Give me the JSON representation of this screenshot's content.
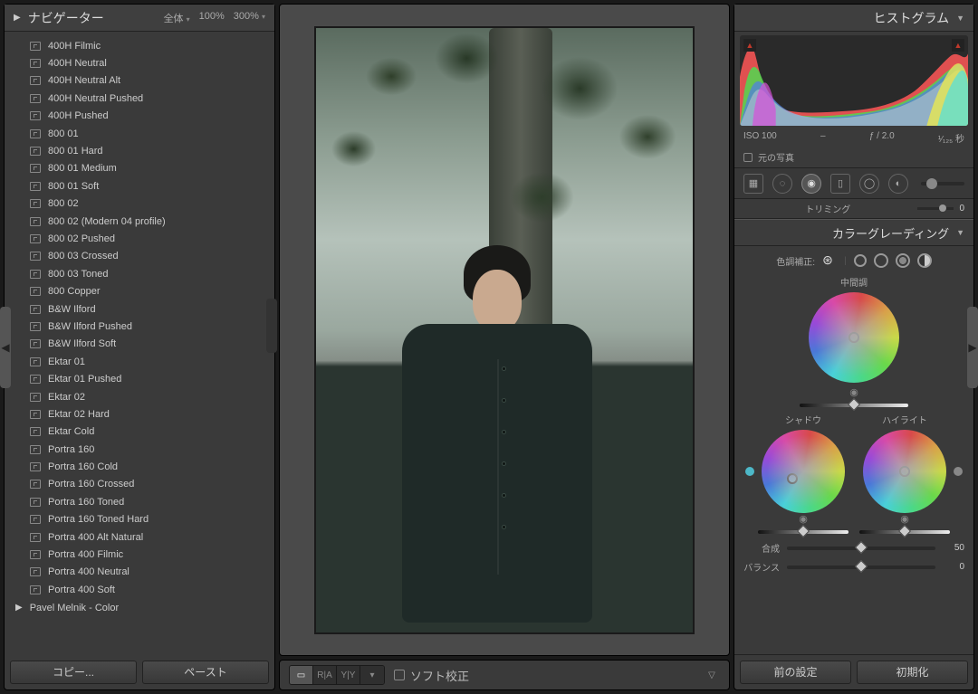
{
  "navigator": {
    "title": "ナビゲーター",
    "zoom_fit": "全体",
    "zoom_100": "100%",
    "zoom_300": "300%"
  },
  "presets": [
    "400H Filmic",
    "400H Neutral",
    "400H Neutral Alt",
    "400H Neutral Pushed",
    "400H Pushed",
    "800 01",
    "800 01 Hard",
    "800 01 Medium",
    "800 01 Soft",
    "800 02",
    "800 02 (Modern 04 profile)",
    "800 02 Pushed",
    "800 03 Crossed",
    "800 03 Toned",
    "800 Copper",
    "B&W Ilford",
    "B&W Ilford Pushed",
    "B&W Ilford Soft",
    "Ektar 01",
    "Ektar 01 Pushed",
    "Ektar 02",
    "Ektar 02 Hard",
    "Ektar Cold",
    "Portra 160",
    "Portra 160 Cold",
    "Portra 160 Crossed",
    "Portra 160 Toned",
    "Portra 160 Toned Hard",
    "Portra 400 Alt Natural",
    "Portra 400 Filmic",
    "Portra 400 Neutral",
    "Portra 400 Soft"
  ],
  "preset_folder": "Pavel Melnik - Color",
  "left_buttons": {
    "copy": "コピー...",
    "paste": "ペースト"
  },
  "center_bottom": {
    "softproof_label": "ソフト校正",
    "modes": [
      "",
      "R|A",
      "Y|Y",
      ""
    ]
  },
  "histogram": {
    "title": "ヒストグラム",
    "iso": "ISO 100",
    "aperture": "ƒ / 2.0",
    "shutter": "¹⁄₁₂₅ 秒",
    "dash": "–",
    "original_label": "元の写真"
  },
  "trim": {
    "label": "トリミング",
    "value": "0"
  },
  "color_grading": {
    "title": "カラーグレーディング",
    "correction_label": "色調補正:",
    "midtone": "中間調",
    "shadow": "シャドウ",
    "highlight": "ハイライト",
    "blend_label": "合成",
    "blend_value": "50",
    "balance_label": "バランス",
    "balance_value": "0"
  },
  "right_buttons": {
    "prev": "前の設定",
    "reset": "初期化"
  }
}
